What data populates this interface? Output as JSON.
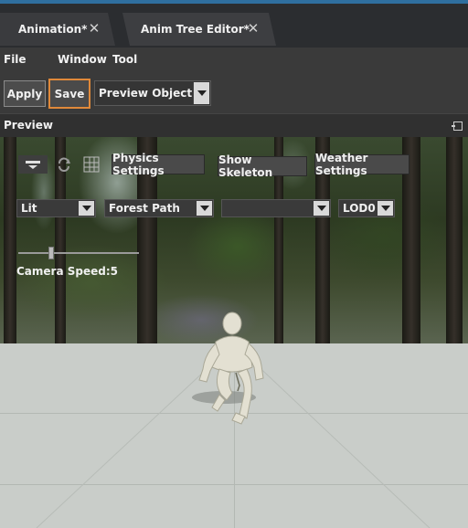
{
  "tabs": [
    {
      "label": "Animation*"
    },
    {
      "label": "Anim Tree Editor*"
    }
  ],
  "menu": {
    "items": [
      {
        "label": "File"
      },
      {
        "label": "Window"
      },
      {
        "label": "Tool"
      }
    ]
  },
  "toolbar": {
    "apply_label": "Apply",
    "save_label": "Save",
    "preview_object": "Preview Object"
  },
  "panel": {
    "title": "Preview"
  },
  "viewport": {
    "buttons": {
      "physics": "Physics Settings",
      "skeleton": "Show Skeleton",
      "weather": "Weather Settings"
    },
    "dropdowns": {
      "lighting": "Lit",
      "environment": "Forest Path",
      "empty": "",
      "lod": "LOD0"
    },
    "camera_speed_label": "Camera Speed:5"
  },
  "colors": {
    "save_highlight": "#e0893a",
    "tab_accent": "#2f6f9f"
  }
}
